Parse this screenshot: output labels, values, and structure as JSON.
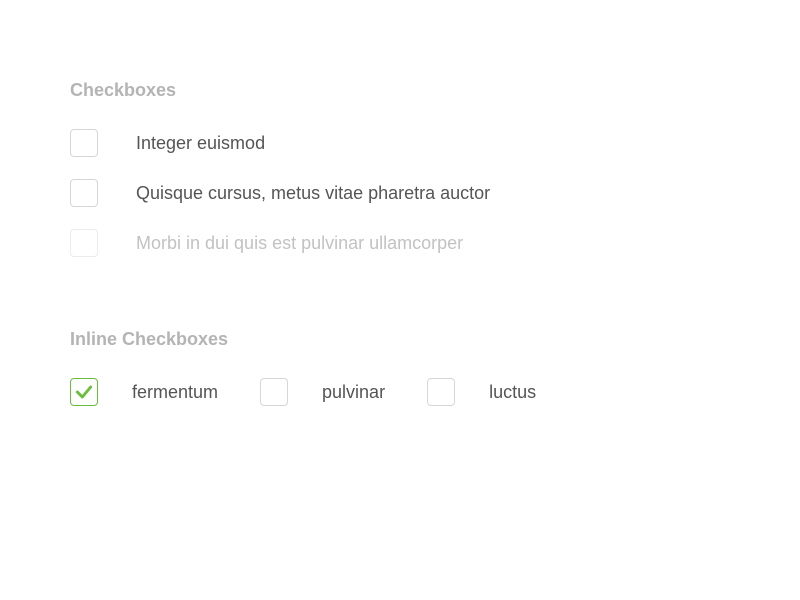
{
  "sections": {
    "stacked": {
      "title": "Checkboxes",
      "items": [
        {
          "label": "Integer euismod",
          "checked": false,
          "disabled": false
        },
        {
          "label": "Quisque cursus, metus vitae pharetra auctor",
          "checked": false,
          "disabled": false
        },
        {
          "label": "Morbi in dui quis est pulvinar ullamcorper",
          "checked": false,
          "disabled": true
        }
      ]
    },
    "inline": {
      "title": "Inline Checkboxes",
      "items": [
        {
          "label": "fermentum",
          "checked": true,
          "disabled": false
        },
        {
          "label": "pulvinar",
          "checked": false,
          "disabled": false
        },
        {
          "label": "luctus",
          "checked": false,
          "disabled": false
        }
      ]
    }
  },
  "colors": {
    "accent": "#6abf3a",
    "muted": "#b4b4b4",
    "text": "#555555",
    "disabled": "#c2c2c2"
  }
}
